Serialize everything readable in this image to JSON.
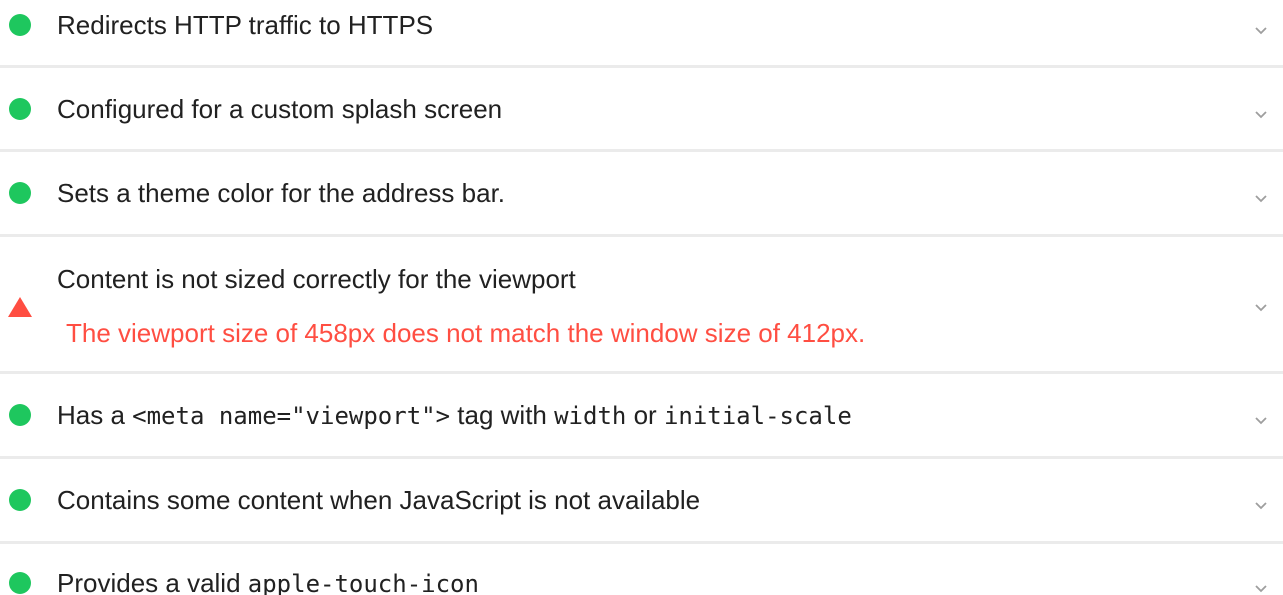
{
  "colors": {
    "pass": "#1ec75e",
    "fail": "#ff4e42",
    "chevron": "#9e9e9e"
  },
  "audits": [
    {
      "status": "pass",
      "title": "Redirects HTTP traffic to HTTPS"
    },
    {
      "status": "pass",
      "title": "Configured for a custom splash screen"
    },
    {
      "status": "pass",
      "title": "Sets a theme color for the address bar."
    },
    {
      "status": "fail",
      "title": "Content is not sized correctly for the viewport",
      "description": "The viewport size of 458px does not match the window size of 412px."
    },
    {
      "status": "pass",
      "title_parts": [
        "Has a ",
        "<meta name=\"viewport\">",
        " tag with ",
        "width",
        " or ",
        "initial-scale"
      ]
    },
    {
      "status": "pass",
      "title": "Contains some content when JavaScript is not available"
    },
    {
      "status": "pass",
      "title_parts": [
        "Provides a valid ",
        "apple-touch-icon"
      ]
    }
  ]
}
